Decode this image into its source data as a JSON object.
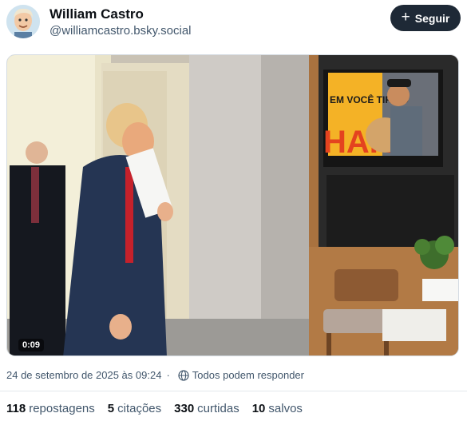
{
  "post": {
    "author_name": "William Castro",
    "author_handle": "@williamcastro.bsky.social",
    "follow_label": "Seguir",
    "video_duration": "0:09",
    "tv_overlay_text": "EM VOCÊ TIRA O",
    "tv_big_text": "HARE",
    "timestamp": "24 de setembro de 2025 às 09:24",
    "reply_setting": "Todos podem responder"
  },
  "stats": [
    {
      "count": "118",
      "label": "repostagens"
    },
    {
      "count": "5",
      "label": "citações"
    },
    {
      "count": "330",
      "label": "curtidas"
    },
    {
      "count": "10",
      "label": "salvos"
    }
  ],
  "icons": {
    "follow": "plus-icon",
    "reply_setting": "globe-icon"
  },
  "colors": {
    "follow_bg": "#1e2936",
    "secondary_text": "#42576c",
    "primary_text": "#0b0f14"
  }
}
